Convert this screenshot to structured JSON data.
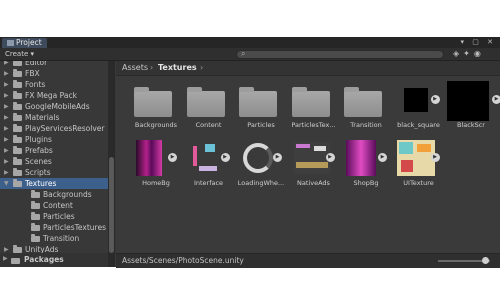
{
  "tab": {
    "title": "Project",
    "controls": "▾ ▢ ✕"
  },
  "toolbar": {
    "create_label": "Create ▾",
    "icons": [
      "tag-icon",
      "star-icon",
      "hide-icon"
    ]
  },
  "tree": {
    "items": [
      {
        "label": "Editor",
        "indent": 1
      },
      {
        "label": "FBX",
        "indent": 1
      },
      {
        "label": "Fonts",
        "indent": 1
      },
      {
        "label": "FX Mega Pack",
        "indent": 1
      },
      {
        "label": "GoogleMobileAds",
        "indent": 1
      },
      {
        "label": "Materials",
        "indent": 1
      },
      {
        "label": "PlayServicesResolver",
        "indent": 1
      },
      {
        "label": "Plugins",
        "indent": 1
      },
      {
        "label": "Prefabs",
        "indent": 1
      },
      {
        "label": "Scenes",
        "indent": 1
      },
      {
        "label": "Scripts",
        "indent": 1
      },
      {
        "label": "Textures",
        "indent": 1,
        "selected": true
      },
      {
        "label": "Backgrounds",
        "indent": 2
      },
      {
        "label": "Content",
        "indent": 2
      },
      {
        "label": "Particles",
        "indent": 2
      },
      {
        "label": "ParticlesTextures",
        "indent": 2
      },
      {
        "label": "Transition",
        "indent": 2
      },
      {
        "label": "UnityAds",
        "indent": 1
      }
    ],
    "packages_label": "Packages"
  },
  "breadcrumb": {
    "root": "Assets",
    "current": "Textures"
  },
  "assets": [
    {
      "name": "Backgrounds",
      "kind": "folder"
    },
    {
      "name": "Content",
      "kind": "folder"
    },
    {
      "name": "Particles",
      "kind": "folder"
    },
    {
      "name": "ParticlesTex...",
      "kind": "folder"
    },
    {
      "name": "Transition",
      "kind": "folder"
    },
    {
      "name": "black_square",
      "kind": "texture-black-small"
    },
    {
      "name": "BlackScr",
      "kind": "texture-black"
    },
    {
      "name": "HomeBg",
      "kind": "texture-homebg"
    },
    {
      "name": "Interface",
      "kind": "texture-interface"
    },
    {
      "name": "LoadingWhe...",
      "kind": "texture-loading"
    },
    {
      "name": "NativeAds",
      "kind": "texture-nativeads"
    },
    {
      "name": "ShopBg",
      "kind": "texture-shopbg"
    },
    {
      "name": "UITexture",
      "kind": "texture-uitexture"
    }
  ],
  "status": {
    "path": "Assets/Scenes/PhotoScene.unity"
  },
  "colors": {
    "selection": "#3c5f8b",
    "panel": "#383838"
  }
}
